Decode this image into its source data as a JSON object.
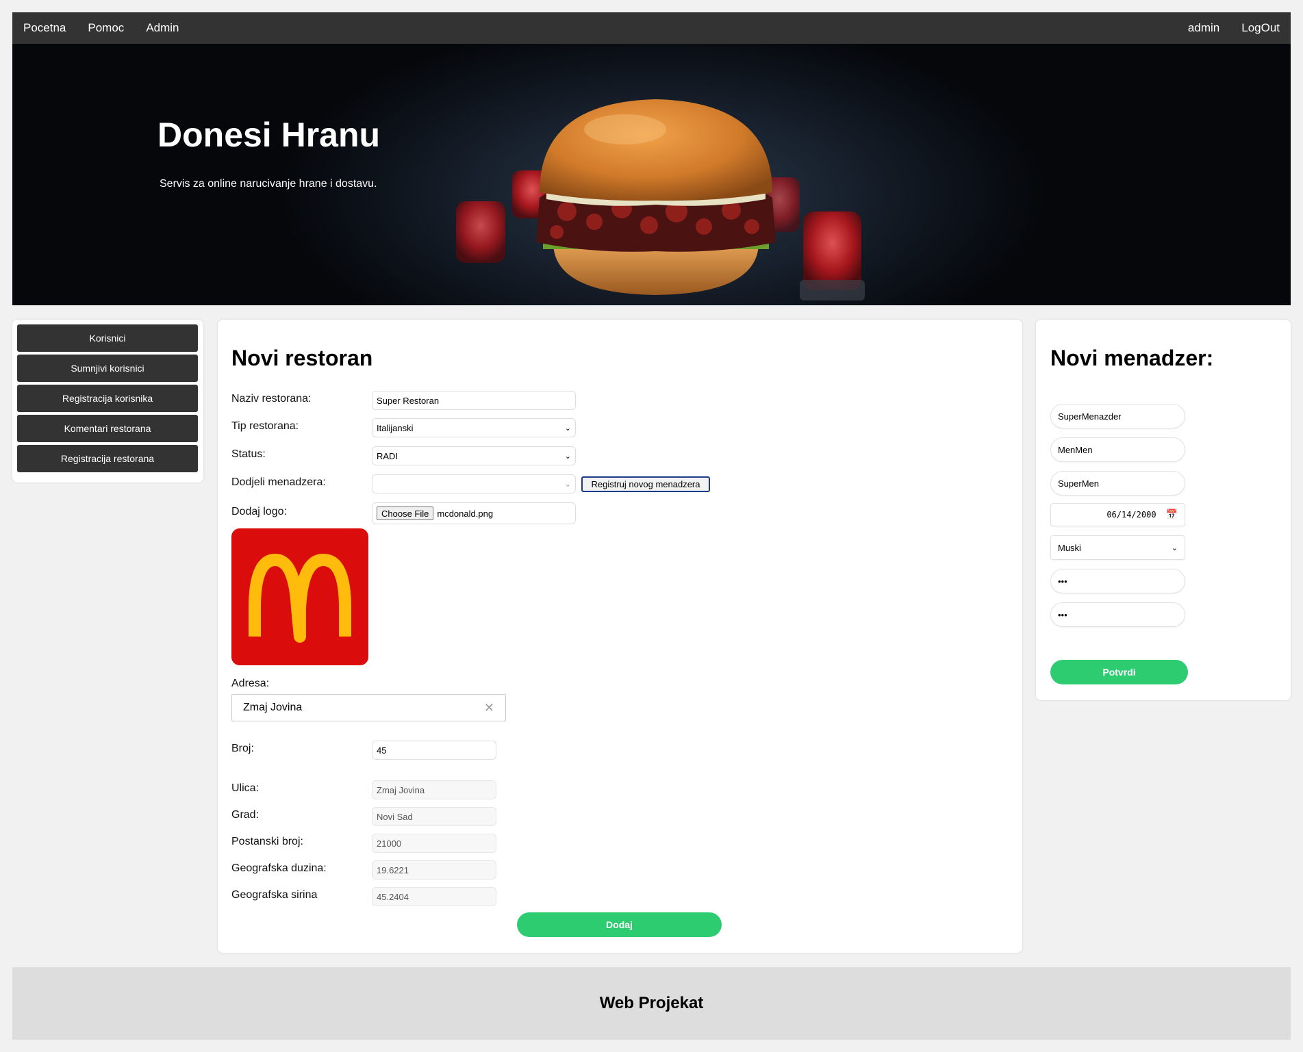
{
  "nav": {
    "home": "Pocetna",
    "help": "Pomoc",
    "admin": "Admin",
    "user": "admin",
    "logout": "LogOut"
  },
  "hero": {
    "title": "Donesi Hranu",
    "subtitle": "Servis za online narucivanje hrane i dostavu."
  },
  "sidebar": {
    "items": [
      {
        "label": "Korisnici"
      },
      {
        "label": "Sumnjivi korisnici"
      },
      {
        "label": "Registracija korisnika"
      },
      {
        "label": "Komentari restorana"
      },
      {
        "label": "Registracija restorana"
      }
    ]
  },
  "form": {
    "title": "Novi restoran",
    "name_label": "Naziv restorana:",
    "name_value": "Super Restoran",
    "type_label": "Tip restorana:",
    "type_value": "Italijanski",
    "status_label": "Status:",
    "status_value": "RADI",
    "manager_label": "Dodjeli menadzera:",
    "manager_value": "",
    "register_manager_button": "Registruj novog menadzera",
    "logo_label": "Dodaj logo:",
    "choose_file": "Choose File",
    "file_name": "mcdonald.png",
    "address_label": "Adresa:",
    "address_value": "Zmaj Jovina",
    "number_label": "Broj:",
    "number_value": "45",
    "street_label": "Ulica:",
    "street_value": "Zmaj Jovina",
    "city_label": "Grad:",
    "city_value": "Novi Sad",
    "zip_label": "Postanski broj:",
    "zip_value": "21000",
    "lon_label": "Geografska duzina:",
    "lon_value": "19.6221",
    "lat_label": "Geografska sirina",
    "lat_value": "45.2404",
    "submit": "Dodaj"
  },
  "manager": {
    "title": "Novi menadzer:",
    "username": "SuperMenazder",
    "first_name": "MenMen",
    "last_name": "SuperMen",
    "birth_date": "06/14/2000",
    "gender": "Muski",
    "password": "•••",
    "password_confirm": "•••",
    "submit": "Potvrdi"
  },
  "footer": {
    "text": "Web Projekat"
  },
  "colors": {
    "nav_bg": "#333333",
    "accent_green": "#2ecc71",
    "logo_red": "#da0c0c",
    "logo_yellow": "#ffbc0d"
  }
}
